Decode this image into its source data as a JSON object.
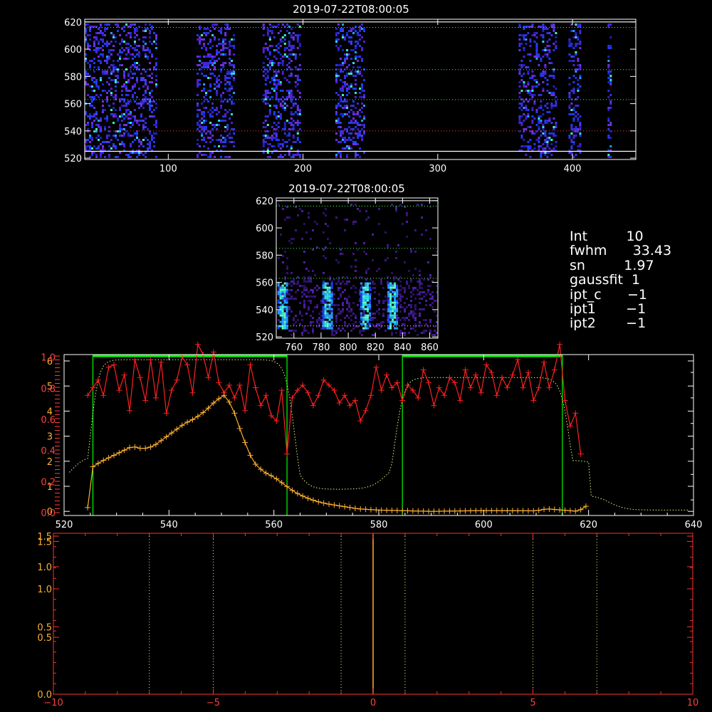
{
  "colors": {
    "background": "#000000",
    "axes": "#ffffff",
    "red_series": "#ff2020",
    "orange_series": "#ffb030",
    "green_band": "#00ff00",
    "dotted_guide": "#e0ff80",
    "bottom_axes": "#ff3030"
  },
  "chart_data": [
    {
      "type": "heatmap",
      "title": "2019-07-22T08:00:05",
      "x_ticks": [
        "100",
        "200",
        "300",
        "400"
      ],
      "y_ticks": [
        "520",
        "540",
        "560",
        "580",
        "600",
        "620"
      ],
      "xlim": [
        38,
        447
      ],
      "ylim": [
        519,
        622
      ],
      "column_bands": [
        [
          38,
          91
        ],
        [
          121,
          148
        ],
        [
          170,
          198
        ],
        [
          224,
          245
        ],
        [
          360,
          387
        ],
        [
          397,
          405
        ],
        [
          426,
          429
        ]
      ],
      "guide_lines_y": [
        525,
        540,
        563,
        585,
        616,
        620
      ],
      "palette": [
        "#2020c0",
        "#3030e0",
        "#5020d0",
        "#7030e0",
        "#1a40ff",
        "#20a0ff",
        "#30e0e0",
        "#40ffb0"
      ]
    },
    {
      "type": "heatmap",
      "title": "2019-07-22T08:00:05",
      "x_ticks": [
        "760",
        "780",
        "800",
        "820",
        "840",
        "860"
      ],
      "y_ticks": [
        "520",
        "540",
        "560",
        "580",
        "600",
        "620"
      ],
      "xlim": [
        747,
        866
      ],
      "ylim": [
        519,
        622
      ],
      "bright_columns_x": [
        751,
        784,
        812,
        832
      ],
      "guide_lines_y": [
        528,
        563,
        585,
        616,
        620
      ]
    },
    {
      "type": "line",
      "x_ticks": [
        "520",
        "540",
        "560",
        "580",
        "600",
        "620",
        "640"
      ],
      "left_ticks": [
        "0.0",
        "0.2",
        "0.4",
        "0.6",
        "0.8",
        "1.0"
      ],
      "right_ticks": [
        "0",
        "1",
        "2",
        "3",
        "4",
        "5",
        "6"
      ],
      "xlim": [
        520,
        640
      ],
      "ylim": [
        0,
        6.2
      ],
      "band_regions": [
        [
          525.5,
          562.5
        ],
        [
          584.5,
          615
        ]
      ],
      "series": [
        {
          "x": [
            524.5,
            525.5,
            526.5,
            527.5,
            528.5,
            529.5,
            530.5,
            531.5,
            532.5,
            533.5,
            534.5,
            535.5,
            536.5,
            537.5,
            538.5,
            539.5,
            540.5,
            541.5,
            542.5,
            543.5,
            544.5,
            545.5,
            546.5,
            547.5,
            548.5,
            549.5,
            550.5,
            551.5,
            552.5,
            553.5,
            554.5,
            555.5,
            556.5,
            557.5,
            558.5,
            559.5,
            560.5,
            561.5,
            562.5,
            563.5,
            564.5,
            565.5,
            566.5,
            567.5,
            568.5,
            569.5,
            570.5,
            571.5,
            572.5,
            573.5,
            574.5,
            575.5,
            576.5,
            577.5,
            578.5,
            579.5,
            580.5,
            581.5,
            582.5,
            583.5,
            584.5,
            585.5,
            586.5,
            587.5,
            588.5,
            589.5,
            590.5,
            591.5,
            592.5,
            593.5,
            594.5,
            595.5,
            596.5,
            597.5,
            598.5,
            599.5,
            600.5,
            601.5,
            602.5,
            603.5,
            604.5,
            605.5,
            606.5,
            607.5,
            608.5,
            609.5,
            610.5,
            611.5,
            612.5,
            613.5,
            614.5,
            615.5,
            616.5,
            617.5,
            618.5
          ],
          "values": [
            4.6,
            4.9,
            5.2,
            4.6,
            5.7,
            5.8,
            4.8,
            5.4,
            4.0,
            6.0,
            5.3,
            4.4,
            6.0,
            4.5,
            5.9,
            3.9,
            4.8,
            5.2,
            6.1,
            5.8,
            4.7,
            6.6,
            6.2,
            5.3,
            6.3,
            5.1,
            4.7,
            5.0,
            4.5,
            5.0,
            4.0,
            5.8,
            4.9,
            4.2,
            4.6,
            3.8,
            3.6,
            4.8,
            2.3,
            4.5,
            4.8,
            5.0,
            4.7,
            4.2,
            4.6,
            5.2,
            5.0,
            4.8,
            4.3,
            4.6,
            4.2,
            4.4,
            3.6,
            4.0,
            4.6,
            5.7,
            4.8,
            5.4,
            4.9,
            5.1,
            4.4,
            5.0,
            4.8,
            4.5,
            5.6,
            5.1,
            4.2,
            4.9,
            4.6,
            5.3,
            5.1,
            4.4,
            5.6,
            4.9,
            5.4,
            4.7,
            5.8,
            5.5,
            4.6,
            5.3,
            4.9,
            5.4,
            6.0,
            4.9,
            5.5,
            4.4,
            4.9,
            5.9,
            4.9,
            5.6,
            6.6,
            4.4,
            3.4,
            3.9,
            2.3
          ],
          "smoothed": true
        },
        {
          "x": [
            524.5,
            525.5,
            526.5,
            527.5,
            528.5,
            529.5,
            530.5,
            531.5,
            532.5,
            533.5,
            534.5,
            535.5,
            536.5,
            537.5,
            538.5,
            539.5,
            540.5,
            541.5,
            542.5,
            543.5,
            544.5,
            545.5,
            546.5,
            547.5,
            548.5,
            549.5,
            550.5,
            551.5,
            552.5,
            553.5,
            554.5,
            555.5,
            556.5,
            557.5,
            558.5,
            559.5,
            560.5,
            561.5,
            562.5,
            563.5,
            564.5,
            565.5,
            566.5,
            567.5,
            568.5,
            569.5,
            570.5,
            571.5,
            572.5,
            573.5,
            574.5,
            575.5,
            576.5,
            577.5,
            578.5,
            579.5,
            580.5,
            581.5,
            582.5,
            583.5,
            584.5,
            585.5,
            586.5,
            587.5,
            588.5,
            589.5,
            590.5,
            591.5,
            592.5,
            593.5,
            594.5,
            595.5,
            596.5,
            597.5,
            598.5,
            599.5,
            600.5,
            601.5,
            602.5,
            603.5,
            604.5,
            605.5,
            606.5,
            607.5,
            608.5,
            609.5,
            610.5,
            611.5,
            612.5,
            613.5,
            614.5,
            615.5,
            616.5,
            617.5,
            618.5,
            619.5
          ],
          "values": [
            0.2,
            0.3,
            0.6,
            0.3,
            0.6,
            0.6,
            0.9,
            0.7,
            0.5,
            0.4,
            0.6,
            0.8,
            0.5,
            0.6,
            0.9,
            0.5,
            0.8,
            0.6,
            0.5,
            0.7,
            0.6,
            0.4,
            0.6,
            0.5,
            0.7,
            0.4,
            0.5,
            0.6,
            0.8,
            0.6,
            0.5,
            0.7,
            0.6,
            0.5,
            0.4,
            0.3,
            0.4,
            0.3,
            0.2,
            0.6,
            0.7,
            0.5,
            0.4,
            0.6,
            0.5,
            0.4,
            0.5,
            0.3,
            0.4,
            0.3,
            0.4,
            0.2,
            0.3,
            0.2,
            0.2,
            0.3,
            0.2,
            0.2,
            0.2,
            0.2,
            0.1,
            0.2,
            0.1,
            0.1,
            0.2,
            0.1,
            0.1,
            0.1,
            0.1,
            0.1,
            0.1,
            0.1,
            0.1,
            0.2,
            0.2,
            0.1,
            0.1,
            0.1,
            0.1,
            0.1,
            0.1,
            0.2,
            0.2,
            0.1,
            0.1,
            0.1,
            0.1,
            0.1,
            0.1,
            0.1,
            0.1,
            0.1,
            0.1,
            0.1,
            0.1,
            0.1
          ]
        }
      ]
    },
    {
      "type": "line",
      "x_ticks": [
        "-10",
        "-5",
        "0",
        "5",
        "10"
      ],
      "y_ticks": [
        "0.0",
        "0.5",
        "0.5",
        "1.0",
        "1.0",
        "1.5",
        "1.5"
      ],
      "xlim": [
        -10,
        10
      ],
      "ylim": [
        0,
        1.5
      ],
      "dotted_lines_x": [
        -7,
        -5,
        -1,
        1,
        5,
        7
      ],
      "solid_line_x": 0
    }
  ],
  "info": {
    "rows": [
      {
        "label": "Int",
        "value": "10"
      },
      {
        "label": "fwhm",
        "value": "33.43"
      },
      {
        "label": "sn",
        "value": "1.97"
      },
      {
        "label": "gaussfit",
        "value": "1"
      },
      {
        "label": "ipt_c",
        "value": "−1"
      },
      {
        "label": "ipt1",
        "value": "−1"
      },
      {
        "label": "ipt2",
        "value": "−1"
      }
    ]
  }
}
